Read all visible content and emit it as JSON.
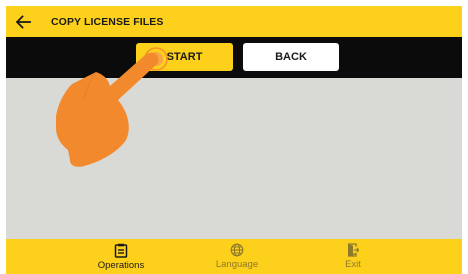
{
  "header": {
    "title": "COPY LICENSE FILES",
    "back_icon": "arrow-left-icon"
  },
  "actions": {
    "start_label": "START",
    "back_label": "BACK"
  },
  "bottom_nav": {
    "items": [
      {
        "label": "Operations",
        "icon": "clipboard-icon",
        "active": true
      },
      {
        "label": "Language",
        "icon": "globe-icon",
        "active": false
      },
      {
        "label": "Exit",
        "icon": "door-exit-icon",
        "active": false
      }
    ]
  },
  "overlay": {
    "icon": "pointing-hand-icon"
  },
  "colors": {
    "accent": "#fdd01c",
    "action_bar": "#0b0b0b",
    "content_bg": "#d9d9d6",
    "hand": "#f2892d",
    "inactive_label": "#8c7a2a"
  }
}
